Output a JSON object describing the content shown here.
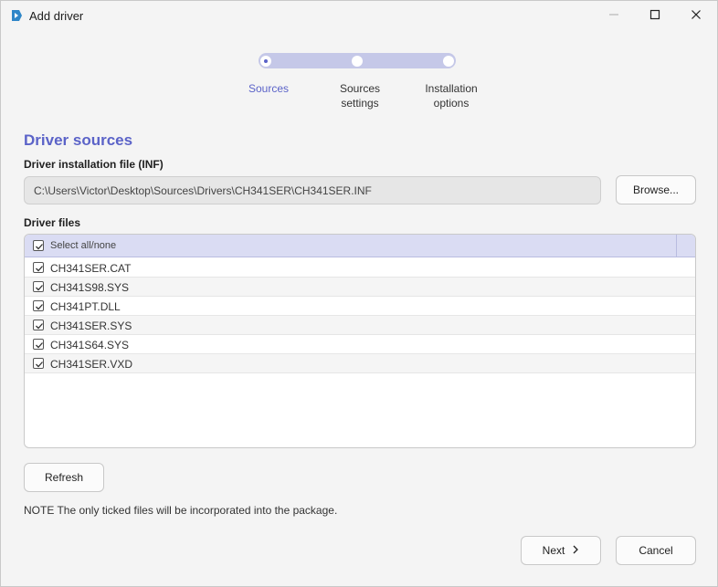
{
  "window": {
    "title": "Add driver",
    "accent": "#5b63c8"
  },
  "stepper": {
    "steps": [
      {
        "label_line1": "Sources",
        "label_line2": "",
        "state": "active"
      },
      {
        "label_line1": "Sources",
        "label_line2": "settings",
        "state": "pending"
      },
      {
        "label_line1": "Installation",
        "label_line2": "options",
        "state": "pending"
      }
    ]
  },
  "section": {
    "title": "Driver sources",
    "inf_label": "Driver installation file (INF)",
    "inf_value": "C:\\Users\\Victor\\Desktop\\Sources\\Drivers\\CH341SER\\CH341SER.INF",
    "browse_label": "Browse...",
    "files_label": "Driver files"
  },
  "file_list": {
    "select_all_label": "Select all/none",
    "select_all_checked": true,
    "files": [
      {
        "name": "CH341SER.CAT",
        "checked": true
      },
      {
        "name": "CH341S98.SYS",
        "checked": true
      },
      {
        "name": "CH341PT.DLL",
        "checked": true
      },
      {
        "name": "CH341SER.SYS",
        "checked": true
      },
      {
        "name": "CH341S64.SYS",
        "checked": true
      },
      {
        "name": "CH341SER.VXD",
        "checked": true
      }
    ]
  },
  "actions": {
    "refresh_label": "Refresh",
    "note": "NOTE The only ticked files will be incorporated into the package.",
    "next_label": "Next",
    "cancel_label": "Cancel"
  }
}
